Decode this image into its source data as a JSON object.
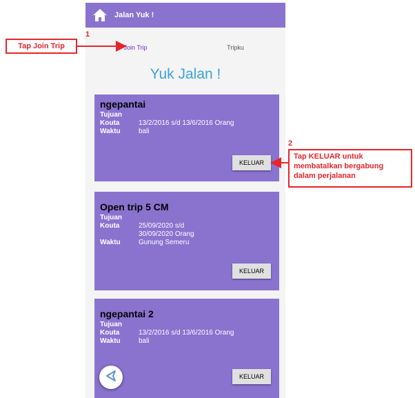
{
  "app": {
    "title": "Jalan Yuk !"
  },
  "tabs": [
    {
      "label": "Join Trip"
    },
    {
      "label": "Tripku"
    }
  ],
  "headline": "Yuk Jalan !",
  "labels": {
    "tujuan": "Tujuan",
    "kouta": "Kouta",
    "waktu": "Waktu",
    "button": "KELUAR"
  },
  "trips": [
    {
      "name": "ngepantai",
      "kouta": "13/2/2016 s/d 13/6/2016 Orang",
      "waktu": "bali"
    },
    {
      "name": "Open trip 5 CM",
      "kouta": "25/09/2020 s/d 30/09/2020 Orang",
      "waktu": "Gunung Semeru"
    },
    {
      "name": "ngepantai 2",
      "kouta": "13/2/2016 s/d 13/6/2016 Orang",
      "waktu": "bali"
    }
  ],
  "annotations": [
    {
      "number": "1",
      "text": "Tap Join Trip"
    },
    {
      "number": "2",
      "text": "Tap KELUAR untuk membatalkan bergabung dalam perjalanan"
    }
  ],
  "colors": {
    "primary": "#8a72cf",
    "accent": "#6a2fb5",
    "headline": "#39a3d8",
    "annotation": "#e5252a"
  },
  "icons": {
    "appbar": "home-icon",
    "fab": "navigation-arrow-icon"
  }
}
